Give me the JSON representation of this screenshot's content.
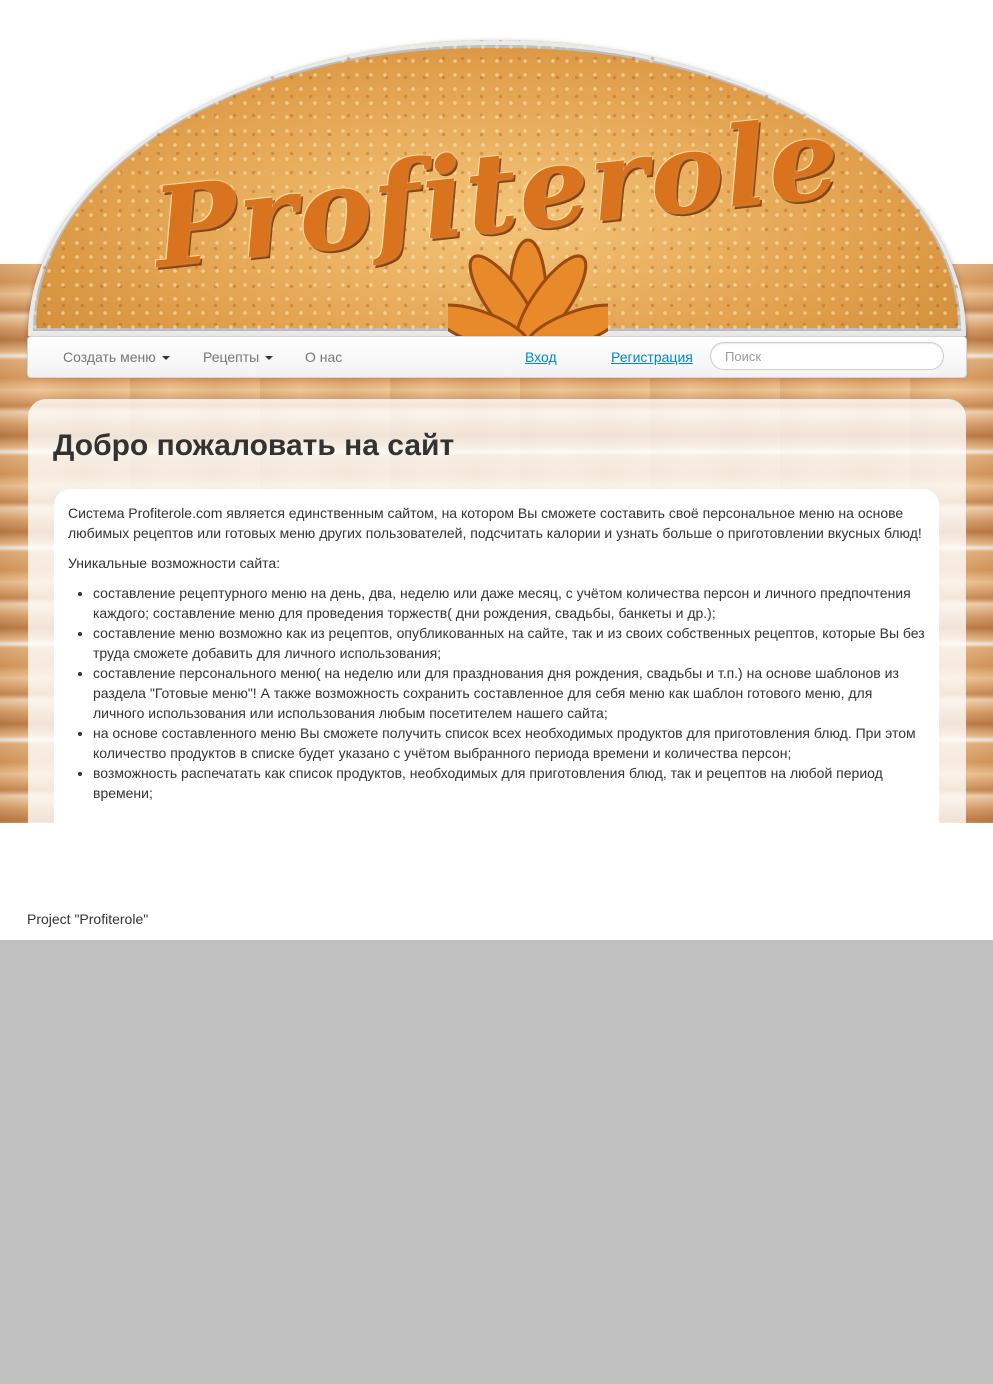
{
  "header": {
    "logo_text": "Profiterole"
  },
  "nav": {
    "items": [
      {
        "label": "Создать меню"
      },
      {
        "label": "Рецепты"
      },
      {
        "label": "О нас"
      }
    ],
    "login": "Вход",
    "register": "Регистрация",
    "search_placeholder": "Поиск"
  },
  "main": {
    "title": "Добро пожаловать на сайт",
    "intro": "Система Profiterole.com является единственным сайтом, на котором Вы сможете составить своё персональное меню на основе любимых рецептов или готовых меню других пользователей, подсчитать калории и узнать больше о приготовлении вкусных блюд!",
    "features_heading": "Уникальные возможности сайта:",
    "features": [
      "составление рецептурного меню на день, два, неделю или даже месяц, с учётом количества персон и личного предпочтения каждого; составление меню для проведения торжеств( дни рождения, свадьбы, банкеты и др.);",
      "составление меню возможно как из рецептов, опубликованных на сайте, так и из своих собственных рецептов, которые Вы без труда сможете добавить для личного использования;",
      "составление персонального меню( на неделю или для празднования дня рождения, свадьбы и т.п.) на основе шаблонов из раздела \"Готовые меню\"! А также возможность сохранить составленное для себя меню как шаблон готового меню, для личного использования или использования любым посетителем нашего сайта;",
      "на основе составленного меню Вы сможете получить список всех необходимых продуктов для приготовления блюд. При этом количество продуктов в списке будет указано с учётом выбранного периода времени и количества персон;",
      "возможность распечатать как список продуктов, необходимых для приготовления блюд, так и рецептов на любой период времени;"
    ]
  },
  "footer": {
    "text": "Project \"Profiterole\""
  },
  "colors": {
    "link": "#0088cc",
    "page_bg": "#c0c0c0",
    "text": "#333333"
  }
}
